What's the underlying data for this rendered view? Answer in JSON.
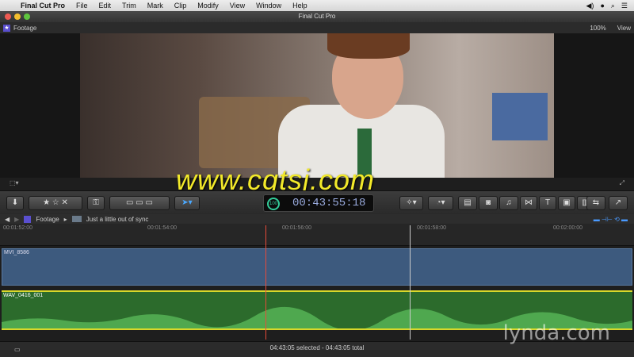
{
  "menu": {
    "apple": "",
    "app": "Final Cut Pro",
    "items": [
      "File",
      "Edit",
      "Trim",
      "Mark",
      "Clip",
      "Modify",
      "View",
      "Window",
      "Help"
    ]
  },
  "window": {
    "title": "Final Cut Pro"
  },
  "viewer": {
    "event": "Footage",
    "zoom": "100%",
    "view_menu": "View"
  },
  "watermark": "www.cgtsj.com",
  "toolbar": {
    "background_tasks": "100",
    "timecode": "00:43:55:18"
  },
  "timeline": {
    "crumb_project": "Footage",
    "crumb_clip": "Just a little out of sync",
    "ruler_ticks": [
      "00:01:52:00",
      "00:01:54:00",
      "00:01:56:00",
      "00:01:58:00",
      "00:02:00:00"
    ],
    "video_clip": "MVI_8586",
    "audio_clip": "WAV_0416_001"
  },
  "status": "04:43:05 selected - 04:43:05 total",
  "branding": "lynda.com"
}
